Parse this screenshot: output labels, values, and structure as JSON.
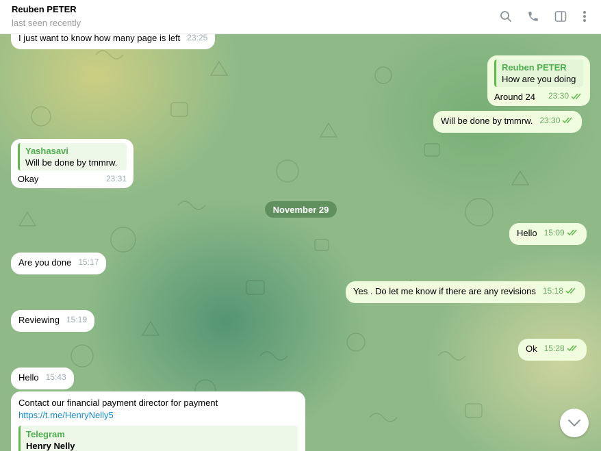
{
  "header": {
    "name": "Reuben PETER",
    "status": "last seen recently"
  },
  "messages": [
    {
      "text": "I just want to know how many page is left",
      "time": "23:25"
    },
    {
      "quote_name": "Reuben PETER",
      "quote_text": "How are you doing",
      "text": "Around 24",
      "time": "23:30"
    },
    {
      "text": "Will be done by tmmrw.",
      "time": "23:30"
    },
    {
      "quote_name": "Yashasavi",
      "quote_text": "Will be done by tmmrw.",
      "text": "Okay",
      "time": "23:31"
    },
    {
      "text": "Hello",
      "time": "15:09"
    },
    {
      "text": "Are you done",
      "time": "15:17"
    },
    {
      "text": "Yes . Do let me know if there are any revisions",
      "time": "15:18"
    },
    {
      "text": "Reviewing",
      "time": "15:19"
    },
    {
      "text": "Ok",
      "time": "15:28"
    },
    {
      "text": "Hello",
      "time": "15:43"
    },
    {
      "text": "Contact our financial payment director for payment",
      "link": "https://t.me/HenryNelly5",
      "preview_site": "Telegram",
      "preview_title": "Henry Nelly"
    }
  ],
  "date_badge": "November 29",
  "colors": {
    "outgoing_bubble": "#effdde",
    "incoming_bubble": "#ffffff",
    "accent": "#4fae4e",
    "link": "#168acd"
  }
}
